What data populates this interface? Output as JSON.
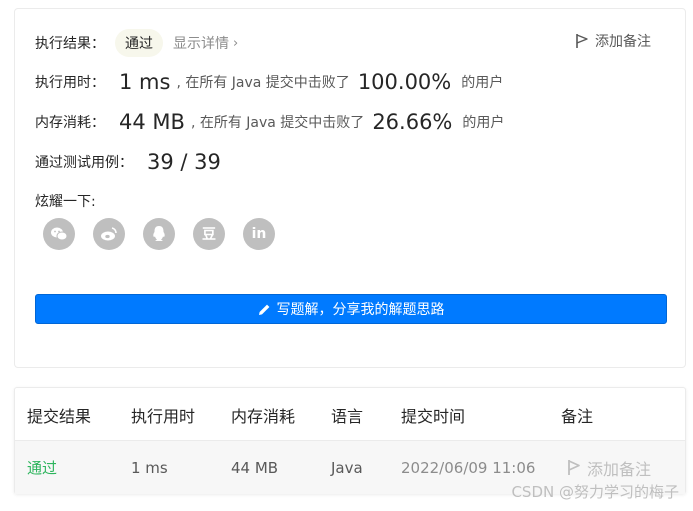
{
  "result": {
    "label": "执行结果：",
    "status": "通过",
    "details_label": "显示详情",
    "details_chevron": "›",
    "add_note": "添加备注"
  },
  "runtime": {
    "label": "执行用时：",
    "value": "1 ms",
    "prefix": ", 在所有 Java 提交中击败了",
    "percent": "100.00%",
    "suffix": "的用户"
  },
  "memory": {
    "label": "内存消耗：",
    "value": "44 MB",
    "prefix": ", 在所有 Java 提交中击败了",
    "percent": "26.66%",
    "suffix": "的用户"
  },
  "tests": {
    "label": "通过测试用例：",
    "value": "39 / 39"
  },
  "share": {
    "label": "炫耀一下:",
    "icons": [
      "wechat-icon",
      "weibo-icon",
      "qq-icon",
      "douban-icon",
      "linkedin-icon"
    ],
    "glyphs": [
      "",
      "",
      "",
      "豆",
      "in"
    ]
  },
  "solution_button": "写题解，分享我的解题思路",
  "table": {
    "headers": [
      "提交结果",
      "执行用时",
      "内存消耗",
      "语言",
      "提交时间",
      "备注"
    ],
    "row": {
      "status": "通过",
      "runtime": "1 ms",
      "memory": "44 MB",
      "language": "Java",
      "time": "2022/06/09 11:06",
      "note": "添加备注"
    }
  },
  "watermark": "CSDN @努力学习的梅子",
  "colors": {
    "primary": "#007aff",
    "pass": "#2db55d",
    "icon_gray": "#bfbfbf"
  }
}
